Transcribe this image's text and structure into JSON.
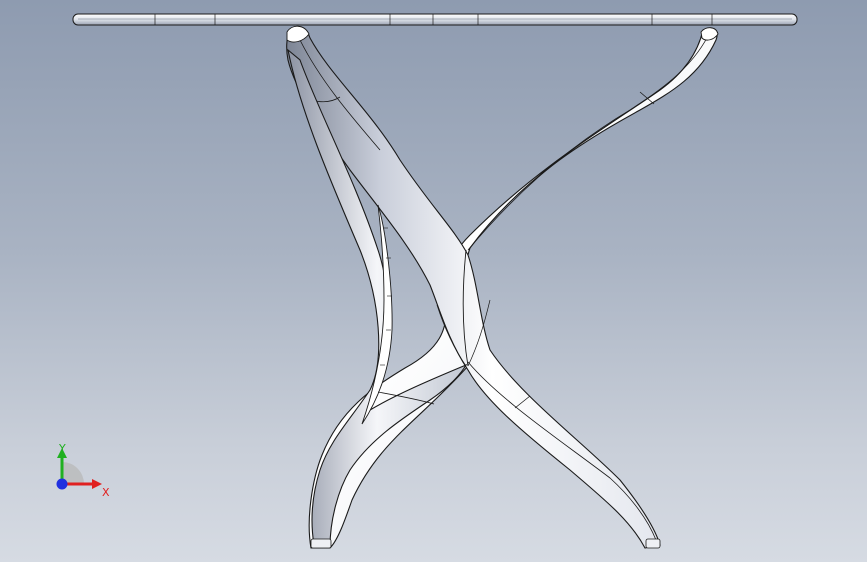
{
  "viewport": {
    "background_top": "#8e9bb0",
    "background_bottom": "#d6dbe3"
  },
  "model": {
    "name": "table-with-crossed-legs",
    "surface_color": "#f2f4f8",
    "edge_color": "#1a1a1a"
  },
  "triad": {
    "x_label": "X",
    "y_label": "Y",
    "x_color": "#e02020",
    "y_color": "#20b020",
    "z_color": "#2030e0"
  }
}
